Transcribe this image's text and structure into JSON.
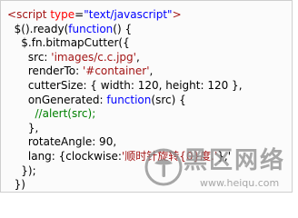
{
  "code": {
    "line1": {
      "open": "<",
      "tag": "script",
      "sp": " ",
      "attr": "type",
      "eq": "=",
      "val": "\"text/javascript\"",
      "close": ">"
    },
    "line2": {
      "indent": "  ",
      "pre": "$().ready(",
      "kw": "function",
      "post": "() {"
    },
    "line3": {
      "indent": "    ",
      "text": "$.fn.bitmapCutter({"
    },
    "line4": {
      "indent": "      ",
      "key": "src: ",
      "str": "'images/c.c.jpg'",
      "end": ","
    },
    "line5": {
      "indent": "      ",
      "key": "renderTo: ",
      "str": "'#container'",
      "end": ","
    },
    "line6": {
      "indent": "      ",
      "text": "cutterSize: { width: 120, height: 120 },"
    },
    "line7": {
      "indent": "      ",
      "key": "onGenerated: ",
      "kw": "function",
      "post": "(src) {"
    },
    "line8": {
      "indent": "        ",
      "comment": "//alert(src);"
    },
    "line9": {
      "indent": "      ",
      "text": "},"
    },
    "line10": {
      "indent": "      ",
      "text": "rotateAngle: 90,"
    },
    "line11": {
      "indent": "      ",
      "key": "lang: {clockwise:",
      "str": "'顺时针旋转{0}度.'",
      "end": "},'"
    },
    "line12": {
      "indent": "    ",
      "text": "});"
    },
    "line13": {
      "indent": "  ",
      "text": "})"
    },
    "line14": {
      "open": "</",
      "tag": "script",
      "close": ">"
    }
  },
  "watermark": {
    "title": "黑区网络",
    "url": "www.heiqu.com",
    "logo_icon": "heiqu-logo-icon"
  },
  "colors": {
    "tag": "#a31515",
    "attr": "#ff0000",
    "string": "#0000ff",
    "keyword": "#0000ff",
    "comment": "#008000",
    "watermark": "#8f8f8f"
  }
}
